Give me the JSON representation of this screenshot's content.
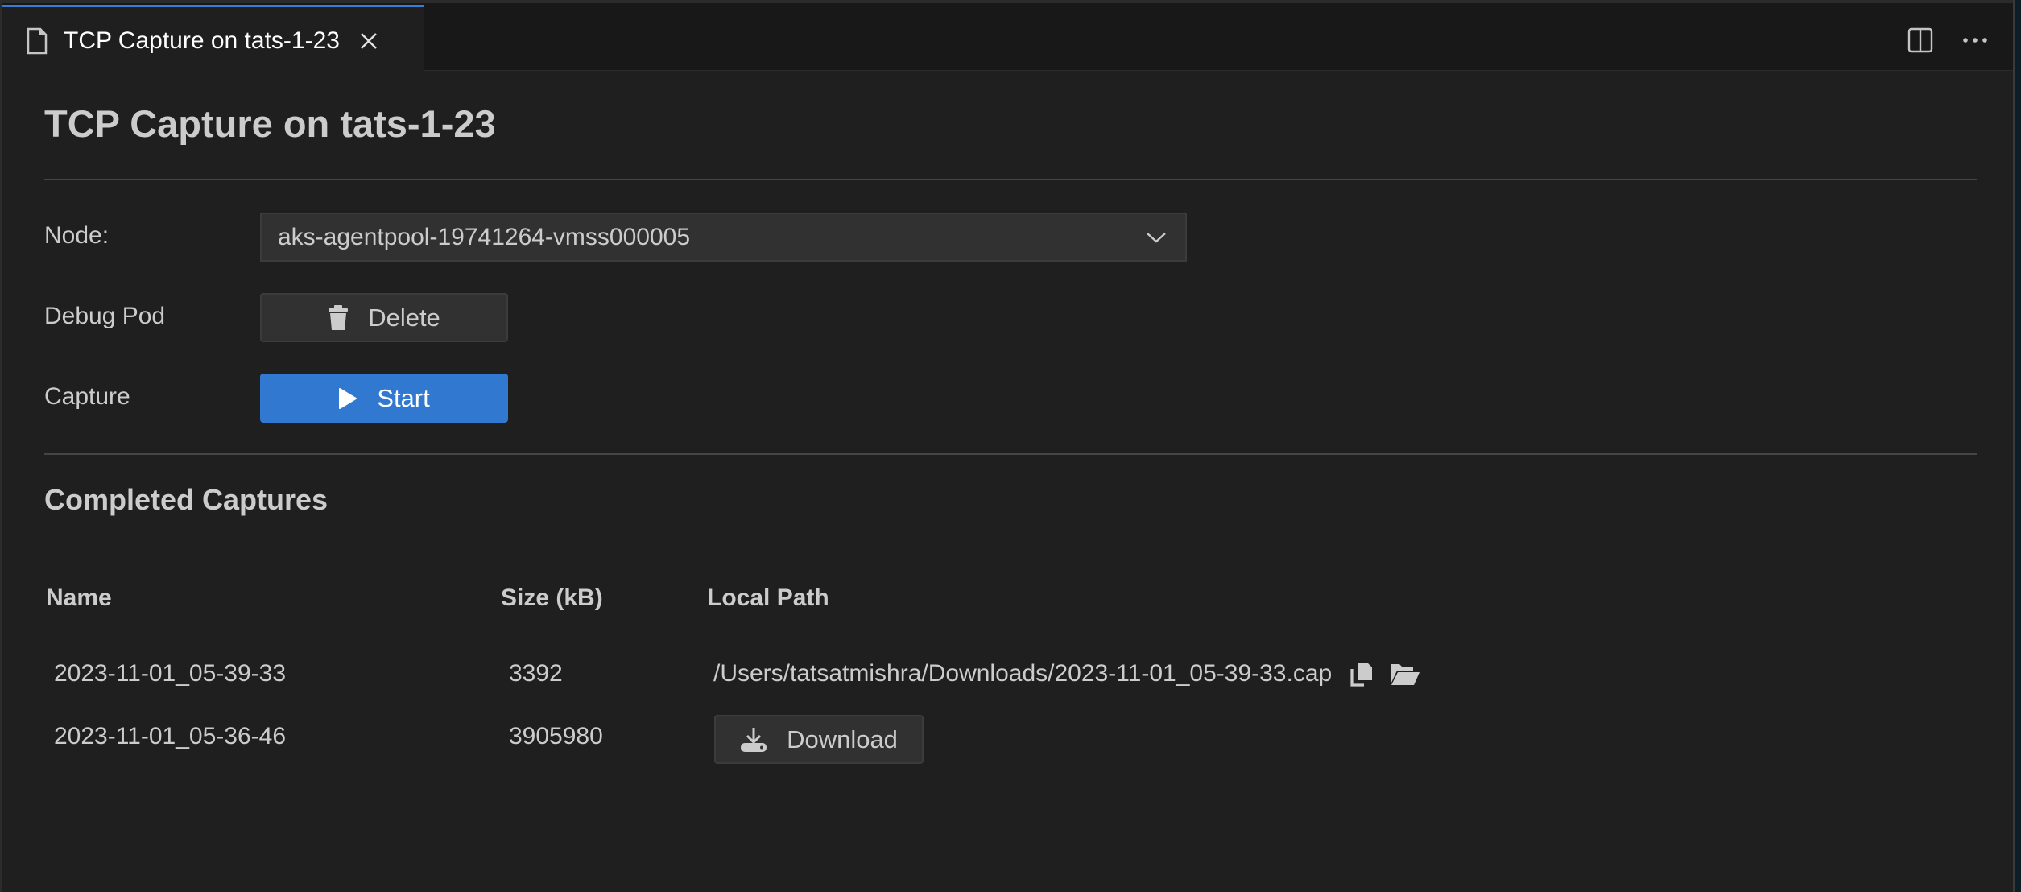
{
  "tab": {
    "title": "TCP Capture on tats-1-23",
    "icon": "file-icon",
    "close_icon": "close-icon"
  },
  "tab_actions": [
    {
      "name": "split-editor",
      "icon": "split-editor-icon"
    },
    {
      "name": "more-actions",
      "icon": "ellipsis-icon"
    }
  ],
  "page": {
    "title": "TCP Capture on tats-1-23"
  },
  "form": {
    "node": {
      "label": "Node:",
      "value": "aks-agentpool-19741264-vmss000005"
    },
    "debug_pod": {
      "label": "Debug Pod",
      "button_label": "Delete",
      "button_icon": "trash-icon"
    },
    "capture": {
      "label": "Capture",
      "button_label": "Start",
      "button_icon": "play-icon"
    }
  },
  "captures": {
    "title": "Completed Captures",
    "columns": [
      "Name",
      "Size (kB)",
      "Local Path"
    ],
    "rows": [
      {
        "name": "2023-11-01_05-39-33",
        "size": "3392",
        "local_path": "/Users/tatsatmishra/Downloads/2023-11-01_05-39-33.cap",
        "path_icons": [
          "copy-icon",
          "open-folder-icon"
        ]
      },
      {
        "name": "2023-11-01_05-36-46",
        "size": "3905980",
        "action_label": "Download",
        "action_icon": "download-icon"
      }
    ]
  },
  "colors": {
    "accent": "#3078d0",
    "background": "#1f1f1f",
    "tab_bar": "#181818",
    "control": "#313131",
    "text": "#cccccc"
  }
}
